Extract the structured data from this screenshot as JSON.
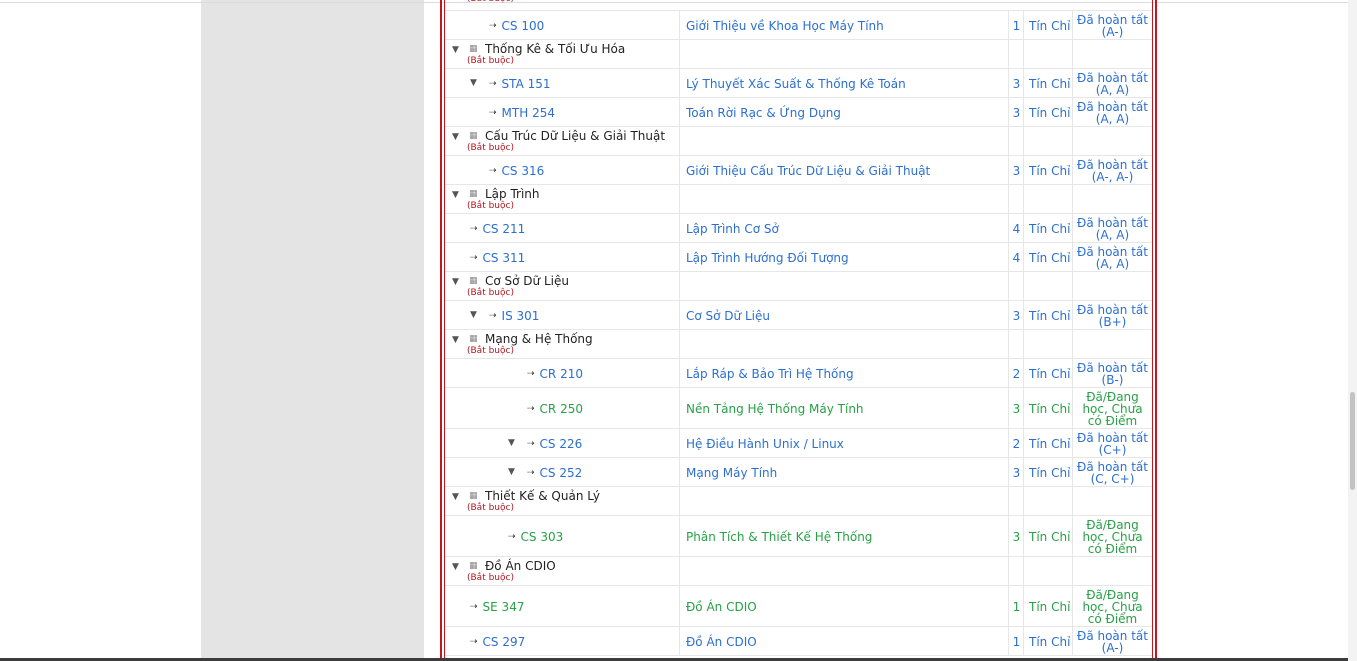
{
  "rows": [
    {
      "kind": "course",
      "code": "CS 100",
      "name": "Giới Thiệu về Khoa Học Máy Tính",
      "credit": "1",
      "unit": "Tín Chỉ",
      "status": "Đã hoàn tất (A-)",
      "green": false,
      "depth": 2,
      "tri": false
    },
    {
      "kind": "group",
      "title": "Thống Kê & Tối Ưu Hóa",
      "req": "(Bắt buộc)"
    },
    {
      "kind": "course",
      "code": "STA 151",
      "name": "Lý Thuyết Xác Suất & Thống Kê Toán",
      "credit": "3",
      "unit": "Tín Chỉ",
      "status": "Đã hoàn tất (A, A)",
      "green": false,
      "depth": 2,
      "tri": true
    },
    {
      "kind": "course",
      "code": "MTH 254",
      "name": "Toán Rời Rạc & Ứng Dụng",
      "credit": "3",
      "unit": "Tín Chỉ",
      "status": "Đã hoàn tất (A, A)",
      "green": false,
      "depth": 2,
      "tri": false
    },
    {
      "kind": "group",
      "title": "Cấu Trúc Dữ Liệu & Giải Thuật",
      "req": "(Bắt buộc)"
    },
    {
      "kind": "course",
      "code": "CS 316",
      "name": "Giới Thiệu Cấu Trúc Dữ Liệu & Giải Thuật",
      "credit": "3",
      "unit": "Tín Chỉ",
      "status": "Đã hoàn tất (A-, A-)",
      "green": false,
      "depth": 2,
      "tri": false
    },
    {
      "kind": "group",
      "title": "Lập Trình",
      "req": "(Bắt buộc)"
    },
    {
      "kind": "course",
      "code": "CS 211",
      "name": "Lập Trình Cơ Sở",
      "credit": "4",
      "unit": "Tín Chỉ",
      "status": "Đã hoàn tất (A, A)",
      "green": false,
      "depth": 1,
      "tri": false
    },
    {
      "kind": "course",
      "code": "CS 311",
      "name": "Lập Trình Hướng Đối Tượng",
      "credit": "4",
      "unit": "Tín Chỉ",
      "status": "Đã hoàn tất (A, A)",
      "green": false,
      "depth": 1,
      "tri": false
    },
    {
      "kind": "group",
      "title": "Cơ Sở Dữ Liệu",
      "req": "(Bắt buộc)"
    },
    {
      "kind": "course",
      "code": "IS 301",
      "name": "Cơ Sở Dữ Liệu",
      "credit": "3",
      "unit": "Tín Chỉ",
      "status": "Đã hoàn tất (B+)",
      "green": false,
      "depth": 2,
      "tri": true
    },
    {
      "kind": "group",
      "title": "Mạng & Hệ Thống",
      "req": "(Bắt buộc)"
    },
    {
      "kind": "course",
      "code": "CR 210",
      "name": "Lắp Ráp & Bảo Trì Hệ Thống",
      "credit": "2",
      "unit": "Tín Chỉ",
      "status": "Đã hoàn tất (B-)",
      "green": false,
      "depth": 4,
      "tri": false
    },
    {
      "kind": "course",
      "code": "CR 250",
      "name": "Nền Tảng Hệ Thống Máy Tính",
      "credit": "3",
      "unit": "Tín Chỉ",
      "status": "Đã/Đang học, Chưa có Điểm",
      "green": true,
      "depth": 4,
      "tri": false
    },
    {
      "kind": "course",
      "code": "CS 226",
      "name": "Hệ Điều Hành Unix / Linux",
      "credit": "2",
      "unit": "Tín Chỉ",
      "status": "Đã hoàn tất (C+)",
      "green": false,
      "depth": 4,
      "tri": true
    },
    {
      "kind": "course",
      "code": "CS 252",
      "name": "Mạng Máy Tính",
      "credit": "3",
      "unit": "Tín Chỉ",
      "status": "Đã hoàn tất (C, C+)",
      "green": false,
      "depth": 4,
      "tri": true
    },
    {
      "kind": "group",
      "title": "Thiết Kế & Quản Lý",
      "req": "(Bắt buộc)"
    },
    {
      "kind": "course",
      "code": "CS 303",
      "name": "Phân Tích & Thiết Kế Hệ Thống",
      "credit": "3",
      "unit": "Tín Chỉ",
      "status": "Đã/Đang học, Chưa có Điểm",
      "green": true,
      "depth": 3,
      "tri": false
    },
    {
      "kind": "group",
      "title": "Đồ Án CDIO",
      "req": "(Bắt buộc)"
    },
    {
      "kind": "course",
      "code": "SE 347",
      "name": "Đồ Án CDIO",
      "credit": "1",
      "unit": "Tín Chỉ",
      "status": "Đã/Đang học, Chưa có Điểm",
      "green": true,
      "depth": 1,
      "tri": false
    },
    {
      "kind": "course",
      "code": "CS 297",
      "name": "Đồ Án CDIO",
      "credit": "1",
      "unit": "Tín Chỉ",
      "status": "Đã hoàn tất (A-)",
      "green": false,
      "depth": 1,
      "tri": false
    }
  ],
  "top_partial_req": "(Bắt buộc)",
  "icons": {
    "expand": "triangle-down-icon",
    "bullet": "arrow-right-icon",
    "group": "grid-dots-icon"
  }
}
